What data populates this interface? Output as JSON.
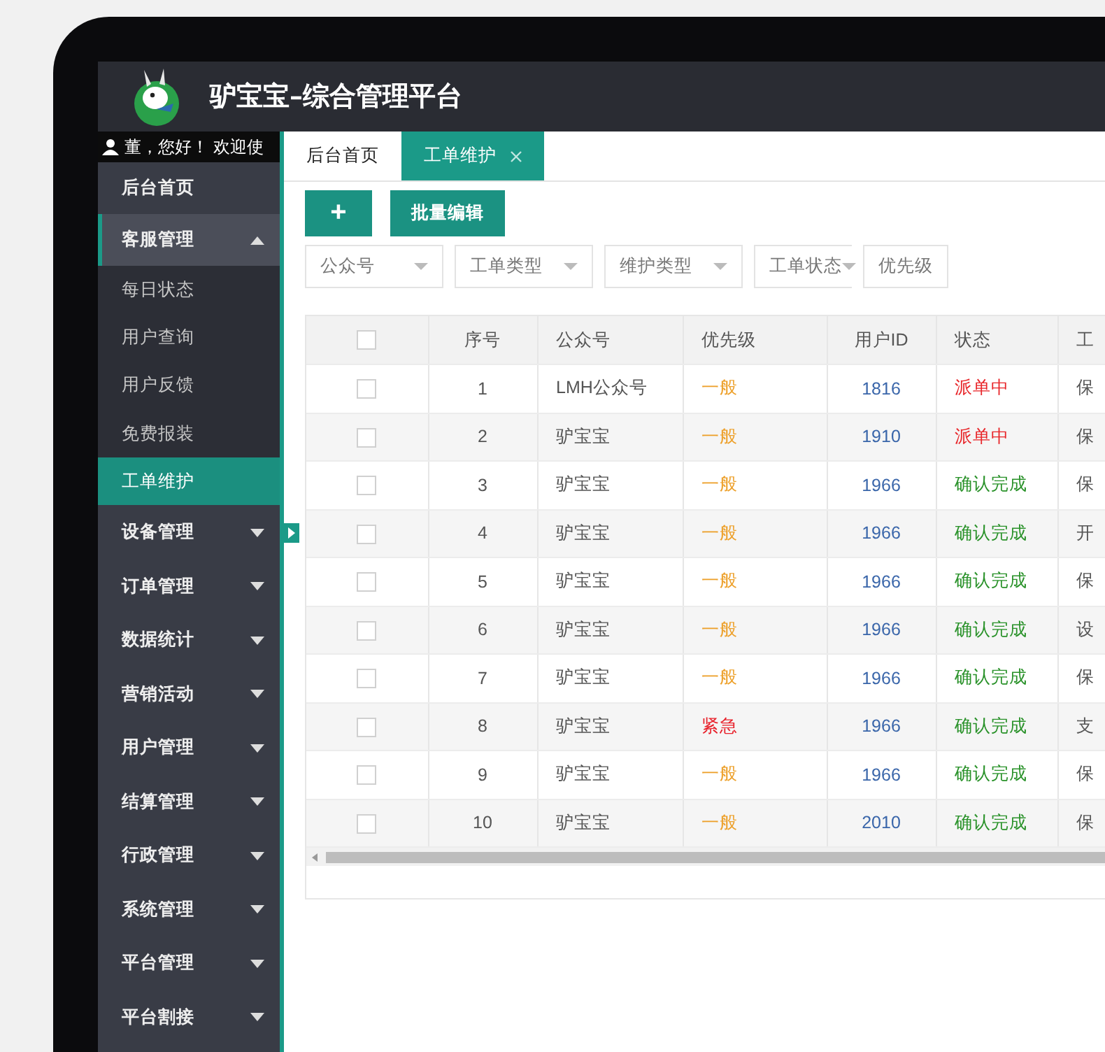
{
  "app": {
    "title": "驴宝宝–综合管理平台"
  },
  "user": {
    "greeting": "董，您好！ 欢迎使"
  },
  "sidebar": {
    "items": [
      {
        "kind": "link",
        "label": "后台首页",
        "selected": false
      },
      {
        "kind": "group",
        "label": "客服管理",
        "expanded": true,
        "children": [
          {
            "label": "每日状态",
            "selected": false
          },
          {
            "label": "用户查询",
            "selected": false
          },
          {
            "label": "用户反馈",
            "selected": false
          },
          {
            "label": "免费报装",
            "selected": false
          },
          {
            "label": "工单维护",
            "selected": true
          }
        ]
      },
      {
        "kind": "group",
        "label": "设备管理",
        "expanded": false
      },
      {
        "kind": "group",
        "label": "订单管理",
        "expanded": false
      },
      {
        "kind": "group",
        "label": "数据统计",
        "expanded": false
      },
      {
        "kind": "group",
        "label": "营销活动",
        "expanded": false
      },
      {
        "kind": "group",
        "label": "用户管理",
        "expanded": false
      },
      {
        "kind": "group",
        "label": "结算管理",
        "expanded": false
      },
      {
        "kind": "group",
        "label": "行政管理",
        "expanded": false
      },
      {
        "kind": "group",
        "label": "系统管理",
        "expanded": false
      },
      {
        "kind": "group",
        "label": "平台管理",
        "expanded": false
      },
      {
        "kind": "group",
        "label": "平台割接",
        "expanded": false
      }
    ]
  },
  "tabs": [
    {
      "label": "后台首页",
      "selected": false,
      "closable": false
    },
    {
      "label": "工单维护",
      "selected": true,
      "closable": true
    }
  ],
  "toolbar": [
    {
      "kind": "icon",
      "label": "+"
    },
    {
      "kind": "text",
      "label": "批量编辑"
    }
  ],
  "filters": [
    {
      "placeholder": "公众号",
      "arrow": true
    },
    {
      "placeholder": "工单类型",
      "arrow": true
    },
    {
      "placeholder": "维护类型",
      "arrow": true
    },
    {
      "placeholder": "工单状态",
      "arrow": true
    },
    {
      "placeholder": "优先级",
      "arrow": false
    }
  ],
  "table": {
    "header_checked": false,
    "columns": [
      "序号",
      "公众号",
      "优先级",
      "用户ID",
      "状态",
      "工"
    ],
    "rows": [
      {
        "checked": false,
        "no": "1",
        "account": "LMH公众号",
        "priority": {
          "label": "一般",
          "color": "#eda02a"
        },
        "user_id": "1816",
        "status": {
          "label": "派单中",
          "color": "#e8262a"
        },
        "column_7": "保"
      },
      {
        "checked": false,
        "no": "2",
        "account": "驴宝宝",
        "priority": {
          "label": "一般",
          "color": "#eda02a"
        },
        "user_id": "1910",
        "status": {
          "label": "派单中",
          "color": "#e8262a"
        },
        "column_7": "保"
      },
      {
        "checked": false,
        "no": "3",
        "account": "驴宝宝",
        "priority": {
          "label": "一般",
          "color": "#eda02a"
        },
        "user_id": "1966",
        "status": {
          "label": "确认完成",
          "color": "#2a922a"
        },
        "column_7": "保"
      },
      {
        "checked": false,
        "no": "4",
        "account": "驴宝宝",
        "priority": {
          "label": "一般",
          "color": "#eda02a"
        },
        "user_id": "1966",
        "status": {
          "label": "确认完成",
          "color": "#2a922a"
        },
        "column_7": "开"
      },
      {
        "checked": false,
        "no": "5",
        "account": "驴宝宝",
        "priority": {
          "label": "一般",
          "color": "#eda02a"
        },
        "user_id": "1966",
        "status": {
          "label": "确认完成",
          "color": "#2a922a"
        },
        "column_7": "保"
      },
      {
        "checked": false,
        "no": "6",
        "account": "驴宝宝",
        "priority": {
          "label": "一般",
          "color": "#eda02a"
        },
        "user_id": "1966",
        "status": {
          "label": "确认完成",
          "color": "#2a922a"
        },
        "column_7": "设"
      },
      {
        "checked": false,
        "no": "7",
        "account": "驴宝宝",
        "priority": {
          "label": "一般",
          "color": "#eda02a"
        },
        "user_id": "1966",
        "status": {
          "label": "确认完成",
          "color": "#2a922a"
        },
        "column_7": "保"
      },
      {
        "checked": false,
        "no": "8",
        "account": "驴宝宝",
        "priority": {
          "label": "紧急",
          "color": "#e8202a"
        },
        "user_id": "1966",
        "status": {
          "label": "确认完成",
          "color": "#2a922a"
        },
        "column_7": "支"
      },
      {
        "checked": false,
        "no": "9",
        "account": "驴宝宝",
        "priority": {
          "label": "一般",
          "color": "#eda02a"
        },
        "user_id": "1966",
        "status": {
          "label": "确认完成",
          "color": "#2a922a"
        },
        "column_7": "保"
      },
      {
        "checked": false,
        "no": "10",
        "account": "驴宝宝",
        "priority": {
          "label": "一般",
          "color": "#eda02a"
        },
        "user_id": "2010",
        "status": {
          "label": "确认完成",
          "color": "#2a922a"
        },
        "column_7": "保"
      }
    ]
  }
}
